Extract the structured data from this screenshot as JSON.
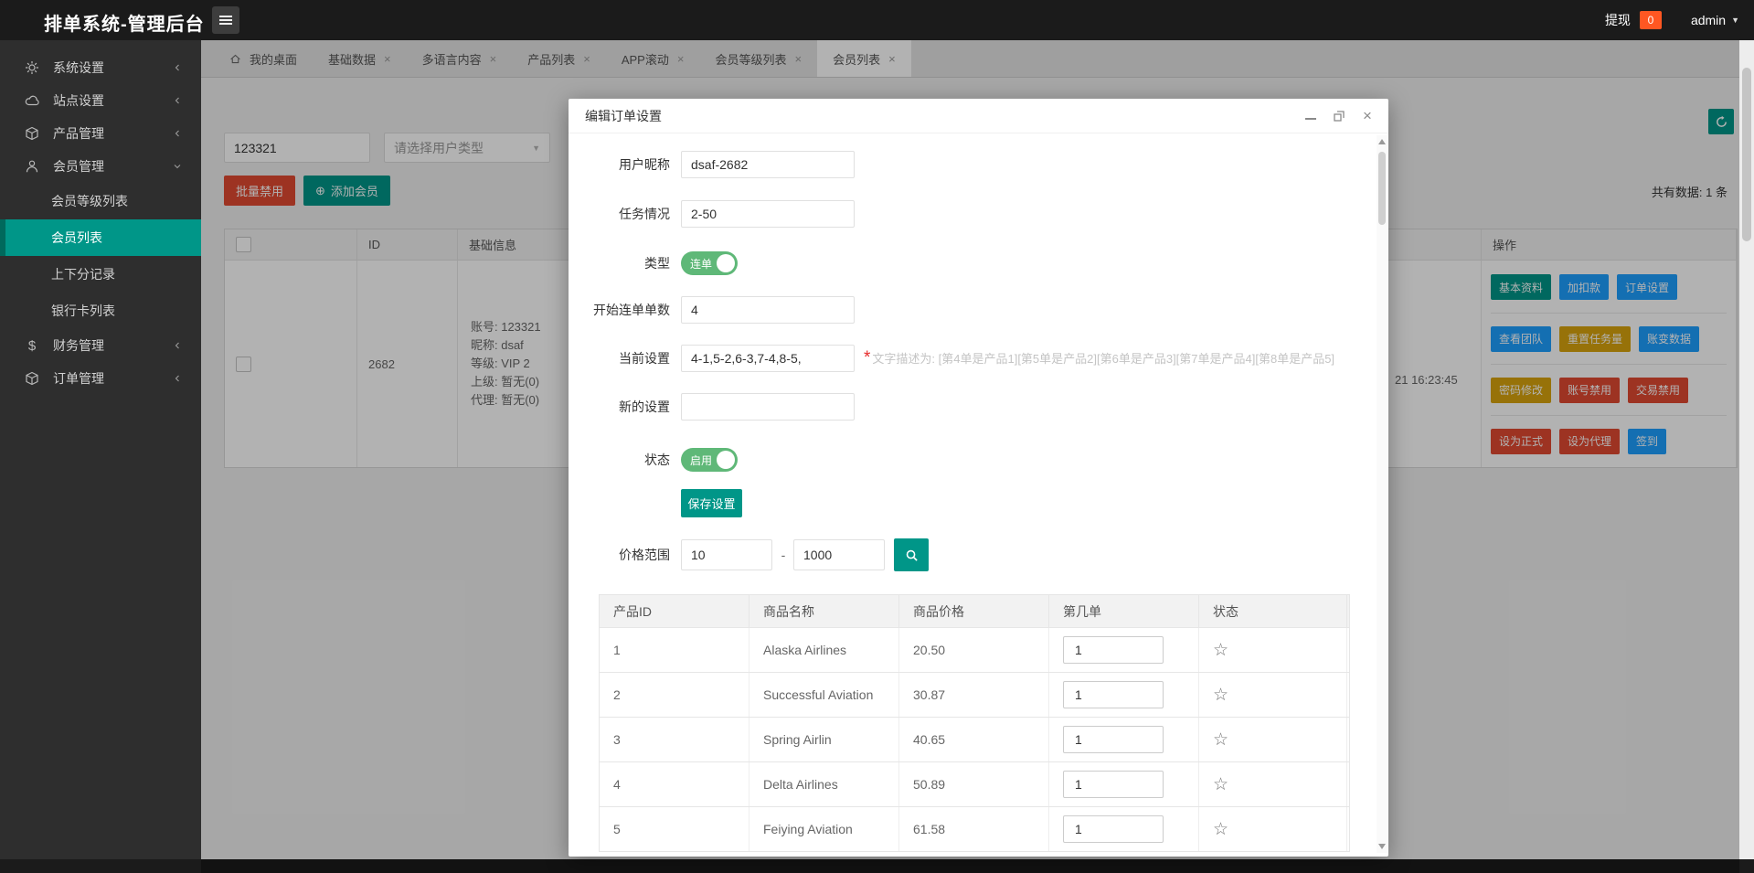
{
  "topbar": {
    "title": "排单系统-管理后台",
    "withdraw_label": "提现",
    "withdraw_badge": "0",
    "username": "admin"
  },
  "tabs": {
    "items": [
      {
        "label": "我的桌面"
      },
      {
        "label": "基础数据"
      },
      {
        "label": "多语言内容"
      },
      {
        "label": "产品列表"
      },
      {
        "label": "APP滚动"
      },
      {
        "label": "会员等级列表"
      },
      {
        "label": "会员列表"
      }
    ]
  },
  "sidebar": {
    "groups": [
      {
        "label": "系统设置"
      },
      {
        "label": "站点设置"
      },
      {
        "label": "产品管理"
      },
      {
        "label": "会员管理",
        "children": [
          {
            "label": "会员等级列表"
          },
          {
            "label": "会员列表"
          },
          {
            "label": "上下分记录"
          },
          {
            "label": "银行卡列表"
          }
        ]
      },
      {
        "label": "财务管理"
      },
      {
        "label": "订单管理"
      }
    ]
  },
  "content": {
    "search_keyword": "123321",
    "user_type_placeholder": "请选择用户类型",
    "batch_disable_label": "批量禁用",
    "add_member_icon": "⊕",
    "add_member_label": "添加会员",
    "total_text": "共有数据: 1 条",
    "table": {
      "headers": {
        "id": "ID",
        "info": "基础信息",
        "ops": "操作"
      },
      "member": {
        "id": "2682",
        "info_lines": [
          "账号: 123321",
          "昵称: dsaf",
          "等级: VIP 2",
          "上级: 暂无(0)",
          "代理: 暂无(0)"
        ],
        "time_fragment": "21 16:23:45"
      }
    },
    "actions": [
      {
        "label": "基本资料",
        "color": "#009688"
      },
      {
        "label": "加扣款",
        "color": "#1E9FFF"
      },
      {
        "label": "订单设置",
        "color": "#1E9FFF"
      },
      {
        "label": "查看团队",
        "color": "#1E9FFF"
      },
      {
        "label": "重置任务量",
        "color": "#d9a40e"
      },
      {
        "label": "账变数据",
        "color": "#1E9FFF"
      },
      {
        "label": "密码修改",
        "color": "#d9a40e"
      },
      {
        "label": "账号禁用",
        "color": "#e14a31"
      },
      {
        "label": "交易禁用",
        "color": "#e14a31"
      },
      {
        "label": "设为正式",
        "color": "#e14a31"
      },
      {
        "label": "设为代理",
        "color": "#e14a31"
      },
      {
        "label": "签到",
        "color": "#1E9FFF"
      }
    ]
  },
  "modal": {
    "title": "编辑订单设置",
    "form": {
      "nickname_label": "用户昵称",
      "nickname_value": "dsaf-2682",
      "task_label": "任务情况",
      "task_value": "2-50",
      "type_label": "类型",
      "type_on_text": "连单",
      "start_label": "开始连单单数",
      "start_value": "4",
      "current_label": "当前设置",
      "current_value": "4-1,5-2,6-3,7-4,8-5,",
      "hint_star": "*",
      "hint_text": "文字描述为: [第4单是产品1][第5单是产品2][第6单是产品3][第7单是产品4][第8单是产品5]",
      "new_label": "新的设置",
      "new_value": "",
      "status_label": "状态",
      "status_on_text": "启用",
      "save_label": "保存设置",
      "price_label": "价格范围",
      "price_min": "10",
      "price_sep": "-",
      "price_max": "1000"
    },
    "table": {
      "headers": [
        "产品ID",
        "商品名称",
        "商品价格",
        "第几单",
        "状态"
      ],
      "rows": [
        {
          "id": "1",
          "name": "Alaska Airlines",
          "price": "20.50",
          "order": "1"
        },
        {
          "id": "2",
          "name": "Successful Aviation",
          "price": "30.87",
          "order": "1"
        },
        {
          "id": "3",
          "name": "Spring Airlin",
          "price": "40.65",
          "order": "1"
        },
        {
          "id": "4",
          "name": "Delta Airlines",
          "price": "50.89",
          "order": "1"
        },
        {
          "id": "5",
          "name": "Feiying Aviation",
          "price": "61.58",
          "order": "1"
        }
      ]
    }
  },
  "colors": {
    "accent_teal": "#009688",
    "blue": "#1E9FFF",
    "gold": "#d9a40e",
    "red": "#e14a31",
    "toggle_green": "#5FB878",
    "badge_orange": "#FF5722"
  }
}
